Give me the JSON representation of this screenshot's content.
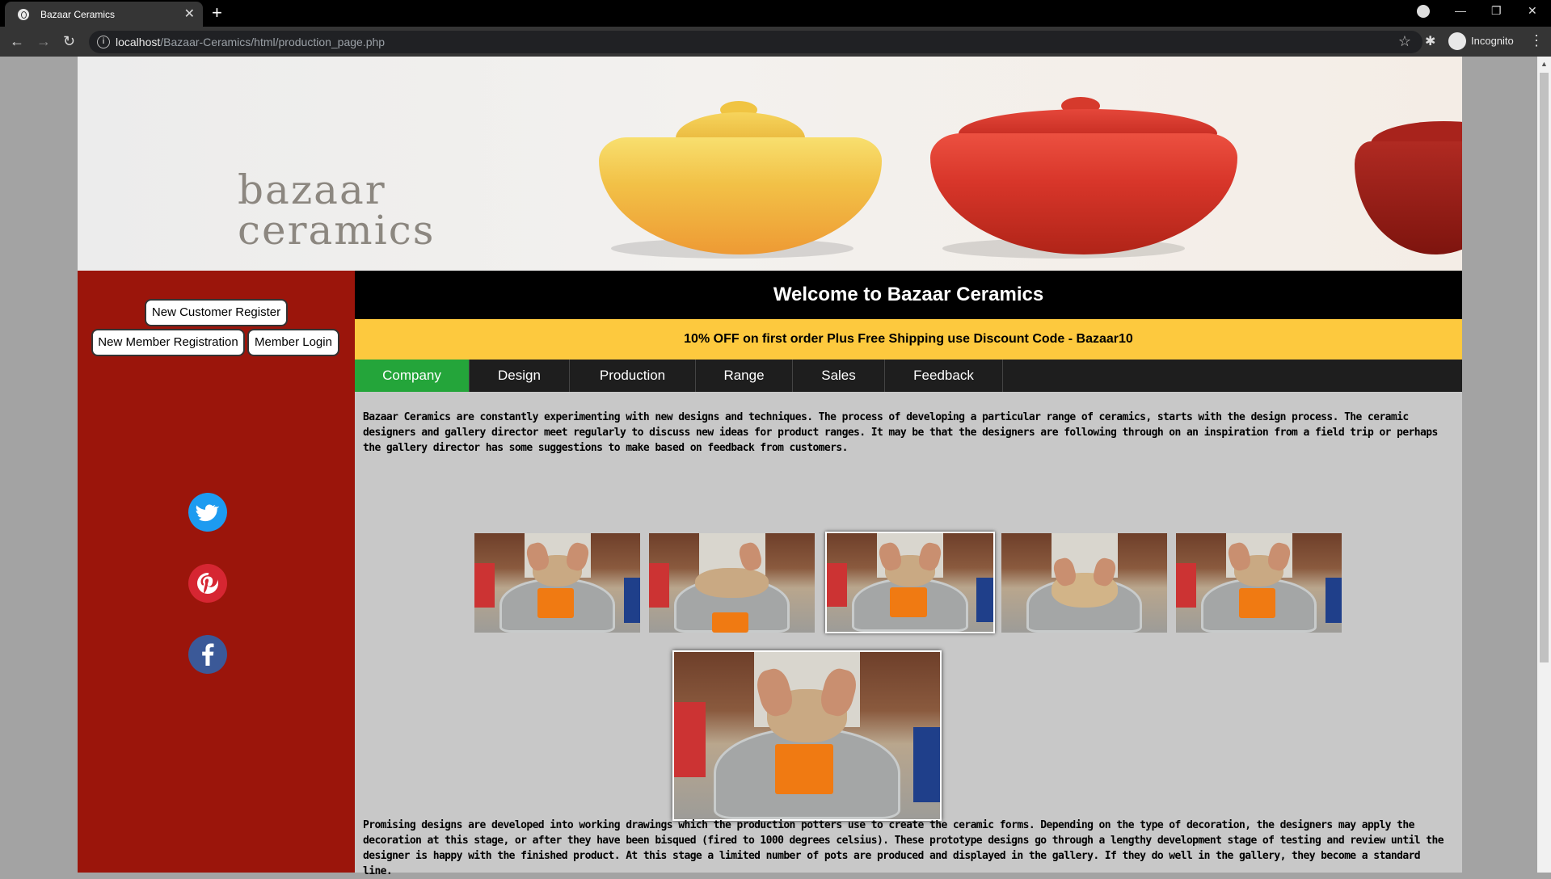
{
  "browser": {
    "tab_title": "Bazaar Ceramics",
    "url_host": "localhost",
    "url_path": "/Bazaar-Ceramics/html/production_page.php",
    "profile_label": "Incognito"
  },
  "banner": {
    "logo_line1": "bazaar",
    "logo_line2": "ceramics"
  },
  "sidebar": {
    "register_label": "New Customer Register",
    "member_registration_label": "New Member Registration",
    "member_login_label": "Member Login",
    "social": [
      "twitter-icon",
      "pinterest-icon",
      "facebook-icon"
    ]
  },
  "main": {
    "welcome": "Welcome to Bazaar Ceramics",
    "promo": "10% OFF on first order Plus Free Shipping use Discount Code - Bazaar10",
    "nav": [
      "Company",
      "Design",
      "Production",
      "Range",
      "Sales",
      "Feedback"
    ],
    "active_nav": "Company",
    "intro": "Bazaar Ceramics are constantly experimenting with new designs and techniques. The process of developing a particular range of ceramics, starts with the design process. The ceramic designers and gallery director meet regularly to discuss new ideas for product ranges. It may be that the designers are following through on an inspiration from a field trip or perhaps the gallery director has some suggestions to make based on feedback from customers.",
    "outro": "Promising designs are developed into working drawings which the production potters use to create the ceramic forms. Depending on the type of decoration, the designers may apply the decoration at this stage, or after they have been bisqued (fired to 1000 degrees celsius). These prototype designs go through a lengthy development stage of testing and review until the designer is happy with the finished product. At this stage a limited number of pots are produced and displayed in the gallery. If they do well in the gallery, they become a standard line."
  },
  "colors": {
    "sidebar": "#9b150b",
    "promo": "#fdc93e",
    "nav_active": "#24a53a",
    "nav_bg": "#1e1e1e"
  }
}
